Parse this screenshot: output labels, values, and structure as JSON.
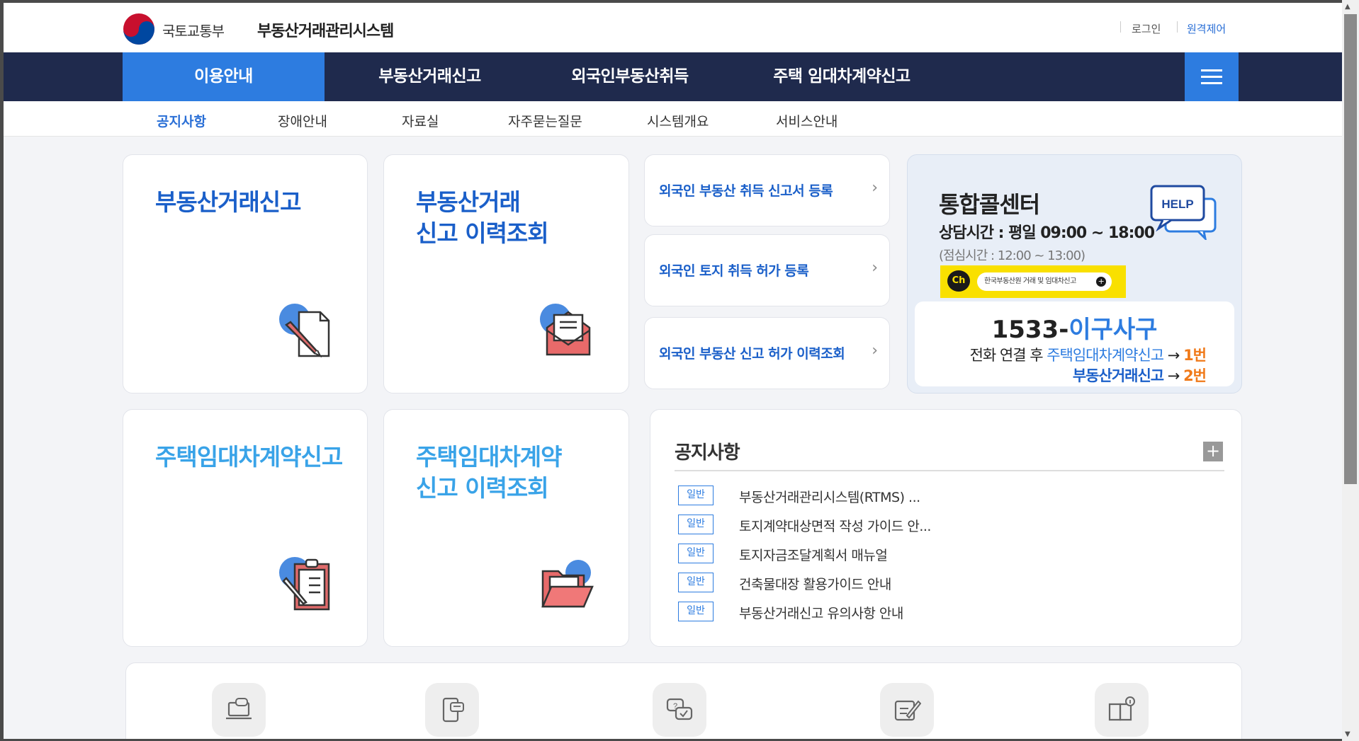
{
  "header": {
    "ministry": "국토교통부",
    "system_name": "부동산거래관리시스템",
    "login": "로그인",
    "remote": "원격제어"
  },
  "main_nav": {
    "items": [
      {
        "label": "이용안내",
        "active": true
      },
      {
        "label": "부동산거래신고",
        "active": false
      },
      {
        "label": "외국인부동산취득",
        "active": false
      },
      {
        "label": "주택 임대차계약신고",
        "active": false
      }
    ],
    "menu_icon": "hamburger-icon"
  },
  "sub_nav": {
    "items": [
      {
        "label": "공지사항",
        "active": true
      },
      {
        "label": "장애안내",
        "active": false
      },
      {
        "label": "자료실",
        "active": false
      },
      {
        "label": "자주묻는질문",
        "active": false
      },
      {
        "label": "시스템개요",
        "active": false
      },
      {
        "label": "서비스안내",
        "active": false
      }
    ]
  },
  "cards": {
    "report": {
      "title": "부동산거래신고",
      "icon": "pencil-document-icon"
    },
    "report_history": {
      "title": "부동산거래\n신고 이력조회",
      "icon": "envelope-letter-icon"
    },
    "lease": {
      "title": "주택임대차계약신고",
      "icon": "clipboard-checklist-icon"
    },
    "lease_history": {
      "title": "주택임대차계약\n신고 이력조회",
      "icon": "open-folder-icon"
    }
  },
  "foreign_links": [
    {
      "label": "외국인 부동산 취득 신고서 등록"
    },
    {
      "label": "외국인 토지 취득 허가 등록"
    },
    {
      "label": "외국인 부동산 신고 허가 이력조회"
    }
  ],
  "call_center": {
    "title": "통합콜센터",
    "hours": "상담시간 : 평일 09:00 ~ 18:00",
    "lunch": "(점심시간 : 12:00 ~ 13:00)",
    "kakao_badge": "Ch",
    "kakao_text": "한국부동산원 거래 및 임대차신고",
    "help_label": "HELP",
    "number_prefix": "1533-",
    "number_suffix": "이구사구",
    "line1_prefix": "전화 연결 후 ",
    "line1_service": "주택임대차계약신고",
    "line1_arrow": " → ",
    "line1_num": "1번",
    "line2_service": "부동산거래신고",
    "line2_arrow": " → ",
    "line2_num": "2번"
  },
  "notice": {
    "title": "공지사항",
    "more": "+",
    "items": [
      {
        "badge": "일반",
        "text": "부동산거래관리시스템(RTMS) ..."
      },
      {
        "badge": "일반",
        "text": "토지계약대상면적 작성 가이드 안..."
      },
      {
        "badge": "일반",
        "text": "토지자금조달계획서 매뉴얼"
      },
      {
        "badge": "일반",
        "text": "건축물대장 활용가이드 안내"
      },
      {
        "badge": "일반",
        "text": "부동산거래신고 유의사항 안내"
      }
    ]
  },
  "quick_icons": [
    "laptop-chat-icon",
    "mobile-chat-icon",
    "qa-bubbles-icon",
    "edit-note-icon",
    "book-info-icon"
  ],
  "colors": {
    "nav_bg": "#1f2a4d",
    "accent_blue": "#2d7ce0",
    "title_blue": "#1a5fc9",
    "light_blue": "#39a3e8",
    "orange": "#f07a1a",
    "kakao_yellow": "#f9e000"
  }
}
